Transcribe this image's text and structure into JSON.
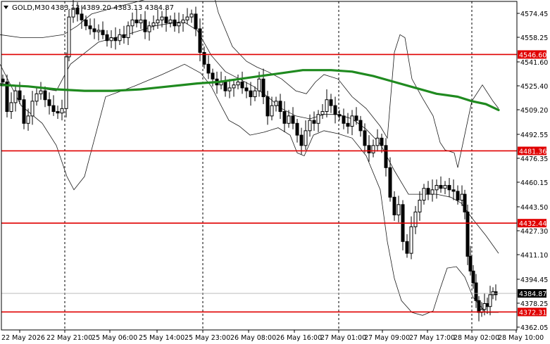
{
  "header": {
    "symbol": "GOLD,M30",
    "ohlc": "4383.13 4389.20 4383.13 4384.87"
  },
  "chart_data": {
    "type": "candlestick",
    "symbol": "GOLD",
    "timeframe": "M30",
    "ylim": [
      4358,
      4600
    ],
    "y_ticks": [
      {
        "value": 4574.45,
        "label": "4574.45"
      },
      {
        "value": 4558.25,
        "label": "4558.25"
      },
      {
        "value": 4541.6,
        "label": "4541.60"
      },
      {
        "value": 4525.4,
        "label": "4525.40"
      },
      {
        "value": 4509.2,
        "label": "4509.20"
      },
      {
        "value": 4492.55,
        "label": "4492.55"
      },
      {
        "value": 4476.35,
        "label": "4476.35"
      },
      {
        "value": 4460.15,
        "label": "4460.15"
      },
      {
        "value": 4443.5,
        "label": "4443.50"
      },
      {
        "value": 4427.3,
        "label": "4427.30"
      },
      {
        "value": 4411.1,
        "label": "4411.10"
      },
      {
        "value": 4394.45,
        "label": "4394.45"
      },
      {
        "value": 4378.25,
        "label": "4378.25"
      },
      {
        "value": 4362.05,
        "label": "4362.05"
      }
    ],
    "x_ticks": [
      "22 May 2026",
      "22 May 21:00",
      "25 May 06:00",
      "25 May 14:00",
      "25 May 23:00",
      "26 May 08:00",
      "26 May 16:00",
      "27 May 01:00",
      "27 May 09:00",
      "27 May 17:00",
      "28 May 02:00",
      "28 May 10:00"
    ],
    "vlines_at_tick": [
      1,
      4,
      7,
      10
    ],
    "levels": [
      {
        "value": 4546.6,
        "label": "4546.60"
      },
      {
        "value": 4481.36,
        "label": "4481.36"
      },
      {
        "value": 4432.44,
        "label": "4432.44"
      },
      {
        "value": 4372.31,
        "label": "4372.31"
      }
    ],
    "current_price": {
      "value": 4384.87,
      "label": "4384.87"
    },
    "moving_average": {
      "points": [
        [
          0,
          4526
        ],
        [
          40,
          4525
        ],
        [
          80,
          4523
        ],
        [
          120,
          4522
        ],
        [
          160,
          4522
        ],
        [
          200,
          4523
        ],
        [
          240,
          4525
        ],
        [
          280,
          4527
        ],
        [
          310,
          4528
        ],
        [
          340,
          4530
        ],
        [
          370,
          4532
        ],
        [
          400,
          4534
        ],
        [
          430,
          4536
        ],
        [
          450,
          4536
        ],
        [
          470,
          4536
        ],
        [
          500,
          4535
        ],
        [
          530,
          4532
        ],
        [
          560,
          4528
        ],
        [
          590,
          4524
        ],
        [
          620,
          4520
        ],
        [
          650,
          4518
        ],
        [
          670,
          4515
        ],
        [
          690,
          4513
        ],
        [
          708,
          4509
        ]
      ]
    },
    "bollinger": {
      "upper": [
        [
          0,
          4560
        ],
        [
          30,
          4558
        ],
        [
          60,
          4558
        ],
        [
          90,
          4560
        ],
        [
          110,
          4566
        ],
        [
          130,
          4574
        ],
        [
          160,
          4578
        ],
        [
          200,
          4583
        ],
        [
          240,
          4588
        ],
        [
          270,
          4596
        ],
        [
          290,
          4603
        ],
        [
          300,
          4594
        ],
        [
          310,
          4575
        ],
        [
          330,
          4552
        ],
        [
          350,
          4542
        ],
        [
          365,
          4538
        ],
        [
          380,
          4535
        ],
        [
          400,
          4530
        ],
        [
          420,
          4522
        ],
        [
          435,
          4520
        ],
        [
          448,
          4528
        ],
        [
          460,
          4533
        ],
        [
          480,
          4530
        ],
        [
          500,
          4518
        ],
        [
          520,
          4510
        ],
        [
          540,
          4498
        ],
        [
          550,
          4490
        ],
        [
          560,
          4548
        ],
        [
          568,
          4560
        ],
        [
          575,
          4558
        ],
        [
          585,
          4530
        ],
        [
          600,
          4517
        ],
        [
          615,
          4505
        ],
        [
          625,
          4487
        ],
        [
          632,
          4482
        ],
        [
          645,
          4480
        ],
        [
          650,
          4470
        ],
        [
          658,
          4488
        ],
        [
          670,
          4515
        ],
        [
          685,
          4526
        ],
        [
          700,
          4515
        ],
        [
          708,
          4510
        ]
      ],
      "middle": [
        [
          0,
          4527
        ],
        [
          40,
          4525
        ],
        [
          80,
          4522
        ],
        [
          100,
          4540
        ],
        [
          140,
          4555
        ],
        [
          180,
          4560
        ],
        [
          220,
          4566
        ],
        [
          260,
          4569
        ],
        [
          280,
          4563
        ],
        [
          300,
          4546
        ],
        [
          320,
          4535
        ],
        [
          340,
          4530
        ],
        [
          360,
          4525
        ],
        [
          380,
          4518
        ],
        [
          400,
          4510
        ],
        [
          420,
          4505
        ],
        [
          440,
          4503
        ],
        [
          460,
          4506
        ],
        [
          480,
          4506
        ],
        [
          500,
          4503
        ],
        [
          520,
          4496
        ],
        [
          540,
          4486
        ],
        [
          560,
          4468
        ],
        [
          580,
          4452
        ],
        [
          600,
          4452
        ],
        [
          620,
          4452
        ],
        [
          640,
          4450
        ],
        [
          655,
          4446
        ],
        [
          670,
          4436
        ],
        [
          690,
          4424
        ],
        [
          708,
          4412
        ]
      ],
      "lower": [
        [
          0,
          4540
        ],
        [
          30,
          4512
        ],
        [
          60,
          4500
        ],
        [
          80,
          4485
        ],
        [
          95,
          4464
        ],
        [
          105,
          4455
        ],
        [
          120,
          4464
        ],
        [
          150,
          4518
        ],
        [
          190,
          4525
        ],
        [
          230,
          4533
        ],
        [
          262,
          4540
        ],
        [
          285,
          4534
        ],
        [
          300,
          4525
        ],
        [
          315,
          4511
        ],
        [
          325,
          4502
        ],
        [
          340,
          4498
        ],
        [
          355,
          4492
        ],
        [
          375,
          4494
        ],
        [
          395,
          4497
        ],
        [
          412,
          4492
        ],
        [
          422,
          4480
        ],
        [
          432,
          4478
        ],
        [
          445,
          4492
        ],
        [
          460,
          4495
        ],
        [
          480,
          4493
        ],
        [
          500,
          4490
        ],
        [
          520,
          4478
        ],
        [
          540,
          4455
        ],
        [
          550,
          4420
        ],
        [
          560,
          4395
        ],
        [
          570,
          4380
        ],
        [
          585,
          4372
        ],
        [
          600,
          4370
        ],
        [
          615,
          4373
        ],
        [
          625,
          4388
        ],
        [
          635,
          4402
        ],
        [
          648,
          4403
        ],
        [
          660,
          4396
        ],
        [
          672,
          4382
        ],
        [
          690,
          4372
        ],
        [
          708,
          4372
        ]
      ]
    }
  }
}
